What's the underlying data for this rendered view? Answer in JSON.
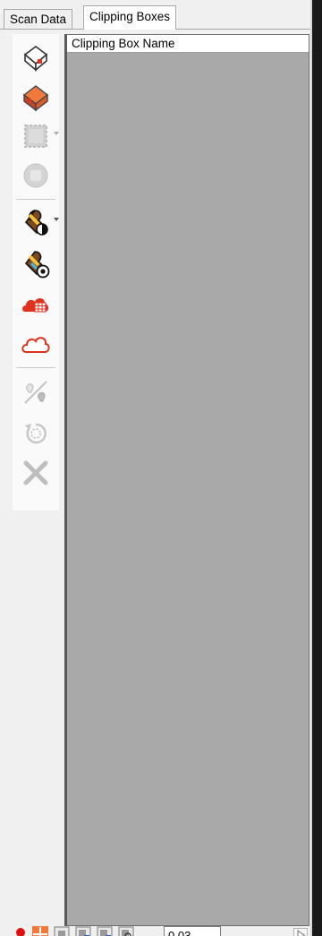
{
  "tabs": [
    {
      "label": "Scan Data",
      "active": false
    },
    {
      "label": "Clipping Boxes",
      "active": true
    }
  ],
  "table": {
    "columns": [
      "Clipping Box Name"
    ],
    "rows": []
  },
  "toolbar": {
    "tools": [
      {
        "icon": "clipping-box-outline-icon",
        "enabled": true
      },
      {
        "icon": "clipping-box-filled-icon",
        "enabled": true
      },
      {
        "icon": "select-region-icon",
        "enabled": false,
        "dropdown": true
      },
      {
        "icon": "stop-circle-icon",
        "enabled": false
      },
      {
        "icon": "paint-bucket-icon",
        "enabled": true,
        "dropdown": true
      },
      {
        "icon": "paint-bucket-settings-icon",
        "enabled": true
      },
      {
        "icon": "cloud-grid-icon",
        "enabled": true
      },
      {
        "icon": "cloud-outline-icon",
        "enabled": true
      },
      {
        "icon": "light-toggle-icon",
        "enabled": false
      },
      {
        "icon": "rotate-icon",
        "enabled": false
      },
      {
        "icon": "delete-x-icon",
        "enabled": false
      }
    ]
  },
  "statusbar": {
    "buttons": [
      "pin-icon",
      "crosshair-icon",
      "view-icon",
      "view-n-icon",
      "view-h-icon",
      "view-zoom-icon",
      "play-icon"
    ],
    "zoom_value": "0.03"
  },
  "colors": {
    "accent_red": "#e0301e",
    "accent_orange": "#f07a3c",
    "grid_background": "#a9a9a9"
  }
}
